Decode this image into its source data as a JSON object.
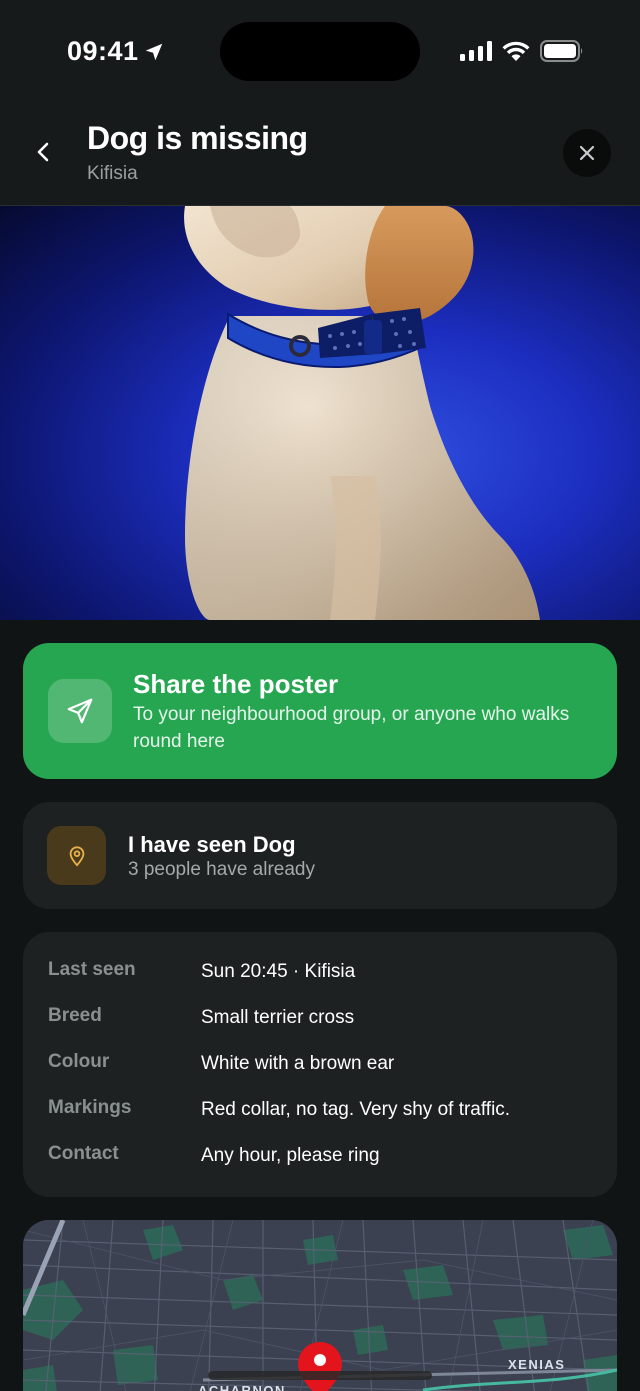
{
  "status_bar": {
    "time": "09:41"
  },
  "header": {
    "title": "Dog is missing",
    "subtitle": "Kifisia"
  },
  "share": {
    "title": "Share the poster",
    "subtitle": "To your neighbourhood group, or anyone who walks round here"
  },
  "seen": {
    "title": "I have seen Dog",
    "subtitle": "3 people have already"
  },
  "details": {
    "rows": [
      {
        "label": "Last seen",
        "value": "Sun 20:45 · Kifisia"
      },
      {
        "label": "Breed",
        "value": "Small terrier cross"
      },
      {
        "label": "Colour",
        "value": "White with a brown ear"
      },
      {
        "label": "Markings",
        "value": "Red collar, no tag. Very shy of traffic."
      },
      {
        "label": "Contact",
        "value": "Any hour, please ring"
      }
    ]
  },
  "map": {
    "labels": [
      "XENIAS",
      "ACHARNON"
    ]
  },
  "colors": {
    "share_green": "#27a651",
    "card_bg": "#1d2121",
    "page_bg": "#111414",
    "pin_red": "#e3141b",
    "seen_icon": "#e8b04a"
  },
  "icons": {
    "back": "chevron-left-icon",
    "close": "close-icon",
    "share": "paper-plane-icon",
    "seen": "map-pin-icon",
    "location": "location-arrow-icon"
  }
}
